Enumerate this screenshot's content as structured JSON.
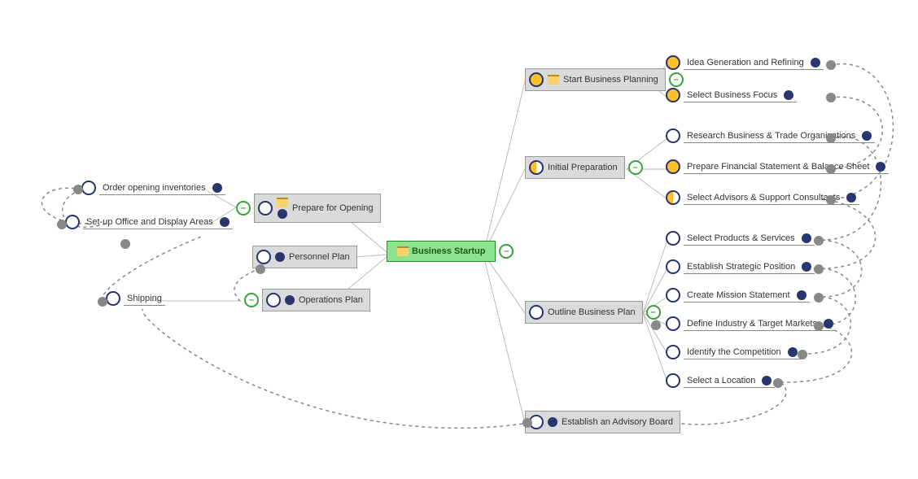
{
  "root": {
    "label": "Business Startup"
  },
  "left": {
    "prepare": {
      "label": "Prepare for Opening",
      "children": {
        "inv": "Order opening inventories",
        "setup": "Set-up Office and Display Areas"
      }
    },
    "personnel": {
      "label": "Personnel Plan"
    },
    "operations": {
      "label": "Operations Plan",
      "children": {
        "ship": "Shipping"
      }
    }
  },
  "right": {
    "start": {
      "label": "Start Business Planning",
      "children": {
        "idea": "Idea Generation and Refining",
        "focus": "Select Business Focus"
      }
    },
    "initial": {
      "label": "Initial Preparation",
      "children": {
        "research": "Research Business & Trade Organizations",
        "finance": "Prepare Financial Statement & Balance Sheet",
        "advisors": "Select Advisors & Support Consultants"
      }
    },
    "outline": {
      "label": "Outline Business Plan",
      "children": {
        "products": "Select Products & Services",
        "strategic": "Establish Strategic Position",
        "mission": "Create Mission Statement",
        "industry": "Define Industry & Target Markets",
        "competition": "Identify the Competition",
        "location": "Select a Location"
      }
    },
    "advisory": {
      "label": "Establish an Advisory Board"
    }
  }
}
